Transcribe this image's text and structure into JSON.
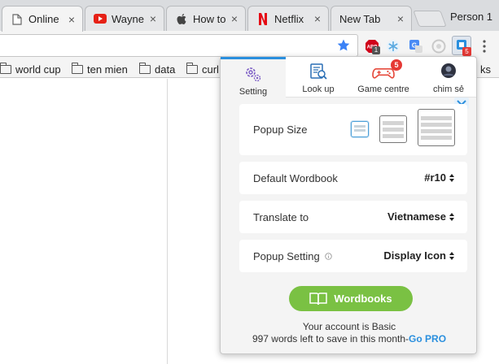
{
  "browser": {
    "tabs": [
      {
        "title": "Online Ir",
        "icon": "document-icon",
        "active": true
      },
      {
        "title": "Wayne F",
        "icon": "youtube-icon"
      },
      {
        "title": "How to t",
        "icon": "apple-icon"
      },
      {
        "title": "Netflix",
        "icon": "netflix-icon"
      },
      {
        "title": "New Tab",
        "icon": ""
      }
    ],
    "profile": "Person 1",
    "extension_badges": {
      "abp": "1",
      "active_ext": "5"
    }
  },
  "bookmarks": [
    {
      "label": "world cup",
      "icon": "folder-icon"
    },
    {
      "label": "ten mien",
      "icon": "folder-icon"
    },
    {
      "label": "data",
      "icon": "folder-icon"
    },
    {
      "label": "curl",
      "icon": "folder-icon"
    },
    {
      "label": "ks",
      "icon": "folder-icon"
    }
  ],
  "popup": {
    "tabs": [
      {
        "label": "Setting",
        "icon": "gear-icon",
        "active": true
      },
      {
        "label": "Look up",
        "icon": "dictionary-search-icon"
      },
      {
        "label": "Game centre",
        "icon": "gamepad-icon",
        "badge": "5"
      },
      {
        "label": "chim sẻ",
        "icon": "avatar"
      }
    ],
    "settings": {
      "popup_size_label": "Popup Size",
      "default_wordbook_label": "Default Wordbook",
      "default_wordbook_value": "#r10",
      "translate_to_label": "Translate to",
      "translate_to_value": "Vietnamese",
      "popup_setting_label": "Popup Setting",
      "popup_setting_value": "Display Icon"
    },
    "wordbooks_button": "Wordbooks",
    "account_line": "Your account is Basic",
    "words_left": "997 words left to save in this month-",
    "go_pro": "Go PRO"
  },
  "colors": {
    "accent": "#2a8fde",
    "button_green": "#7ac143",
    "badge_red": "#e53935"
  }
}
